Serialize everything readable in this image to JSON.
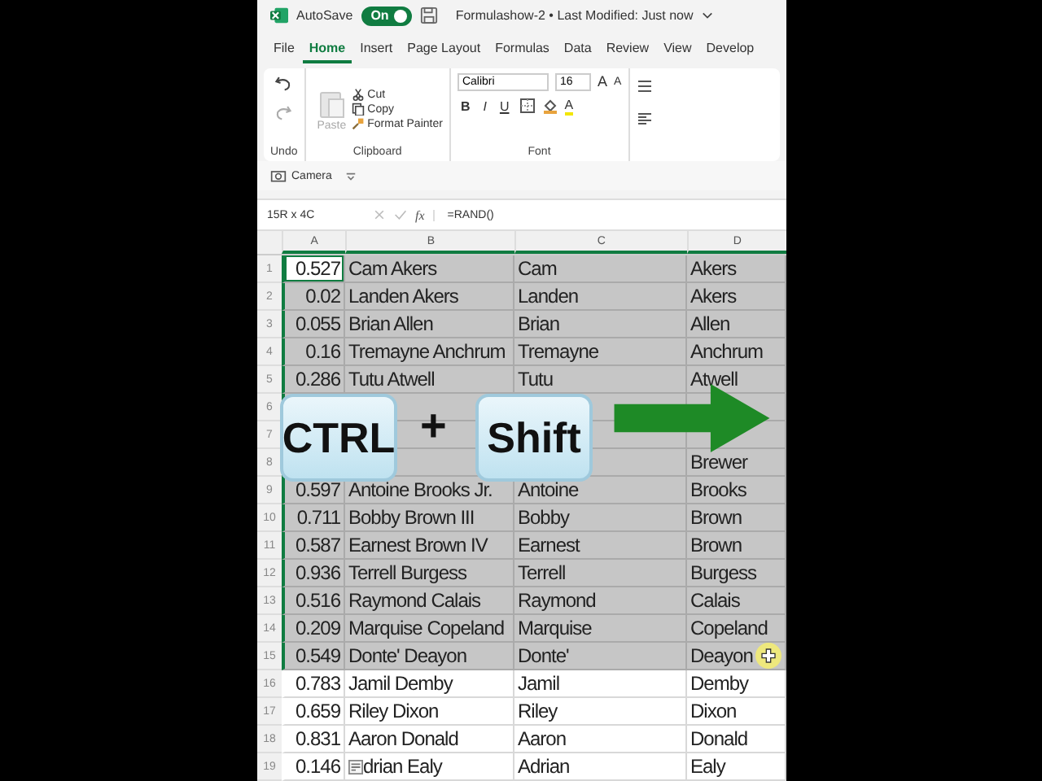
{
  "title_bar": {
    "autosave_label": "AutoSave",
    "autosave": {
      "label": "On",
      "on": true
    },
    "document_title": "Formulashow-2 • Last Modified: Just now"
  },
  "ribbon_tabs": [
    {
      "label": "File",
      "selected": false
    },
    {
      "label": "Home",
      "selected": true
    },
    {
      "label": "Insert",
      "selected": false
    },
    {
      "label": "Page Layout",
      "selected": false
    },
    {
      "label": "Formulas",
      "selected": false
    },
    {
      "label": "Data",
      "selected": false
    },
    {
      "label": "Review",
      "selected": false
    },
    {
      "label": "View",
      "selected": false
    },
    {
      "label": "Develop",
      "selected": false
    }
  ],
  "ribbon": {
    "groups": [
      {
        "kind": "undo",
        "label": "Undo"
      },
      {
        "kind": "clipboard",
        "label": "Clipboard",
        "paste": "Paste",
        "items": [
          "Cut",
          "Copy",
          "Format Painter"
        ]
      },
      {
        "kind": "font",
        "label": "Font",
        "font_name": "Calibri",
        "font_size": "16",
        "size_buttons": [
          "A",
          "A"
        ],
        "style_buttons": [
          "B",
          "I",
          "U"
        ],
        "font_color": "A"
      }
    ]
  },
  "quick_access": {
    "camera": "Camera"
  },
  "formula_bar": {
    "name_box": "15R x 4C",
    "fx": "fx",
    "formula": "=RAND()"
  },
  "sheet": {
    "columns": [
      "A",
      "B",
      "C",
      "D"
    ],
    "rows": [
      {
        "number": "1",
        "selected": true,
        "active": true,
        "cells": [
          "0.527",
          "Cam Akers",
          "Cam",
          "Akers"
        ]
      },
      {
        "number": "2",
        "selected": true,
        "active": false,
        "cells": [
          "0.02",
          "Landen Akers",
          "Landen",
          "Akers"
        ]
      },
      {
        "number": "3",
        "selected": true,
        "active": false,
        "cells": [
          "0.055",
          "Brian Allen",
          "Brian",
          "Allen"
        ]
      },
      {
        "number": "4",
        "selected": true,
        "active": false,
        "cells": [
          "0.16",
          "Tremayne Anchrum",
          "Tremayne",
          "Anchrum"
        ]
      },
      {
        "number": "5",
        "selected": true,
        "active": false,
        "cells": [
          "0.286",
          "Tutu Atwell",
          "Tutu",
          "Atwell"
        ]
      },
      {
        "number": "6",
        "selected": true,
        "active": false,
        "cells": [
          null,
          null,
          null,
          null
        ]
      },
      {
        "number": "7",
        "selected": true,
        "active": false,
        "cells": [
          null,
          null,
          null,
          null
        ]
      },
      {
        "number": "8",
        "selected": true,
        "active": false,
        "cells": [
          null,
          null,
          null,
          "Brewer"
        ]
      },
      {
        "number": "9",
        "selected": true,
        "active": false,
        "cells": [
          "0.597",
          "Antoine Brooks Jr.",
          "Antoine",
          "Brooks"
        ]
      },
      {
        "number": "10",
        "selected": true,
        "active": false,
        "cells": [
          "0.711",
          "Bobby Brown III",
          "Bobby",
          "Brown"
        ]
      },
      {
        "number": "11",
        "selected": true,
        "active": false,
        "cells": [
          "0.587",
          "Earnest Brown IV",
          "Earnest",
          "Brown"
        ]
      },
      {
        "number": "12",
        "selected": true,
        "active": false,
        "cells": [
          "0.936",
          "Terrell Burgess",
          "Terrell",
          "Burgess"
        ]
      },
      {
        "number": "13",
        "selected": true,
        "active": false,
        "cells": [
          "0.516",
          "Raymond Calais",
          "Raymond",
          "Calais"
        ]
      },
      {
        "number": "14",
        "selected": true,
        "active": false,
        "cells": [
          "0.209",
          "Marquise Copeland",
          "Marquise",
          "Copeland"
        ]
      },
      {
        "number": "15",
        "selected": true,
        "active": false,
        "cursor": true,
        "cells": [
          "0.549",
          "Donte' Deayon",
          "Donte'",
          "Deayon"
        ]
      },
      {
        "number": "16",
        "selected": false,
        "active": false,
        "cells": [
          "0.783",
          "Jamil Demby",
          "Jamil",
          "Demby"
        ]
      },
      {
        "number": "17",
        "selected": false,
        "active": false,
        "cells": [
          "0.659",
          "Riley Dixon",
          "Riley",
          "Dixon"
        ]
      },
      {
        "number": "18",
        "selected": false,
        "active": false,
        "cells": [
          "0.831",
          "Aaron Donald",
          "Aaron",
          "Donald"
        ]
      },
      {
        "number": "19",
        "selected": false,
        "active": false,
        "quick_analysis": true,
        "cells": [
          "0.146",
          "drian Ealy",
          "Adrian",
          "Ealy"
        ]
      }
    ]
  },
  "shortcut_overlay": {
    "keys": [
      "CTRL",
      "Shift"
    ],
    "joiner": "+"
  }
}
